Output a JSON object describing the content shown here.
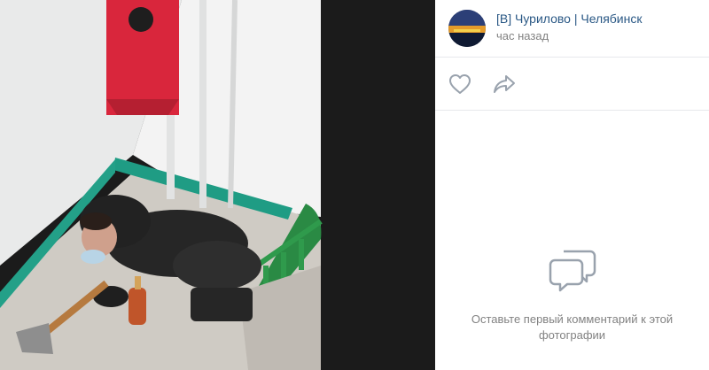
{
  "post": {
    "group_name": "[В] Чурилово | Челябинск",
    "time": "час назад"
  },
  "actions": {
    "like_icon": "heart-icon",
    "share_icon": "share-arrow-icon"
  },
  "comments": {
    "empty_text": "Оставьте первый комментарий к этой фотографии",
    "empty_icon": "comment-bubbles-icon"
  },
  "colors": {
    "link": "#2a5885",
    "muted": "#828282",
    "icon": "#99a2ad",
    "viewer_bg": "#1c1c1c"
  }
}
